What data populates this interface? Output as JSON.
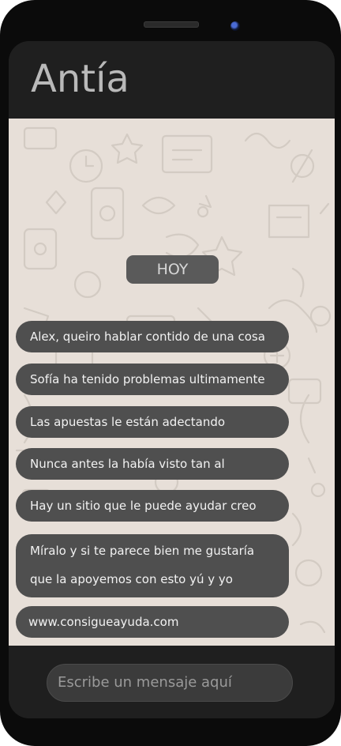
{
  "header": {
    "contact_name": "Antía"
  },
  "chat": {
    "date_label": "HOY",
    "messages": [
      {
        "lines": [
          "Alex, queiro hablar contido de una cosa"
        ]
      },
      {
        "lines": [
          "Sofía ha tenido problemas ultimamente"
        ]
      },
      {
        "lines": [
          "Las apuestas le están adectando"
        ]
      },
      {
        "lines": [
          "Nunca antes la había visto tan al"
        ]
      },
      {
        "lines": [
          "Hay un sitio que le puede ayudar creo"
        ]
      },
      {
        "lines": [
          "Míralo  y si te parece bien me gustaría",
          "que la apoyemos con esto yú y yo"
        ]
      },
      {
        "lines": [
          "www.consigueayuda.com"
        ]
      }
    ]
  },
  "composer": {
    "placeholder": "Escribe un mensaje aquí"
  },
  "colors": {
    "phone_body": "#0b0b0b",
    "screen_bar": "#1f1f1f",
    "chat_background": "#e7dfd8",
    "bubble": "#4f4f4f",
    "bubble_text": "#f2f2f2"
  }
}
